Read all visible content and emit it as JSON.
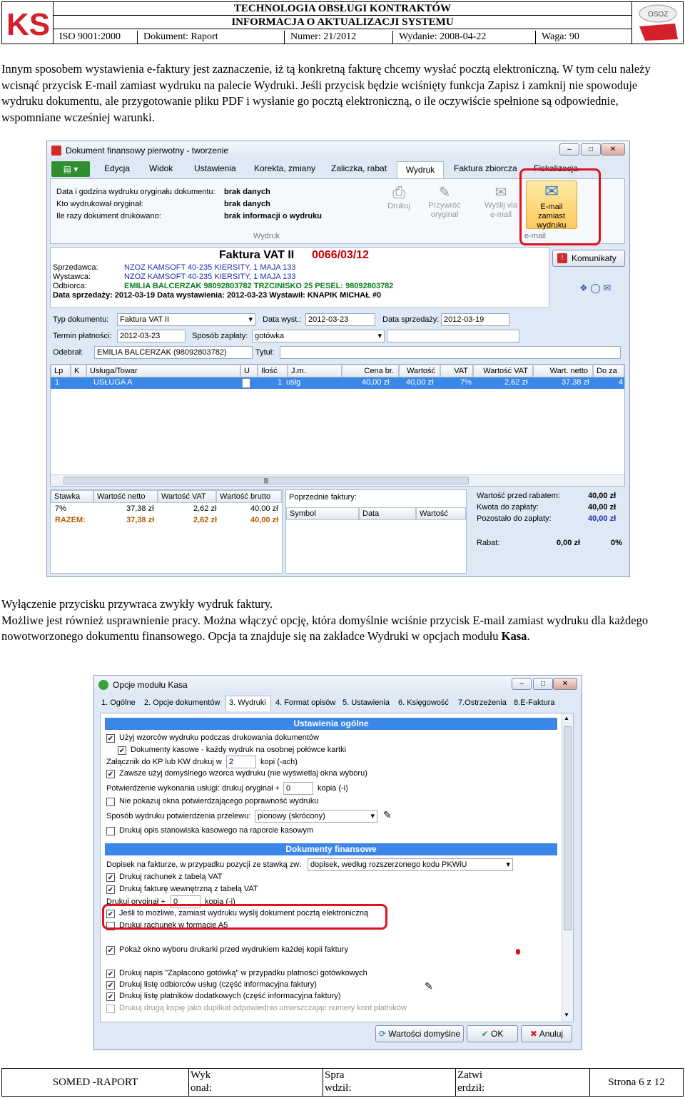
{
  "header": {
    "title1": "TECHNOLOGIA OBSŁUGI KONTRAKTÓW",
    "title2": "INFORMACJA O AKTUALIZACJI SYSTEMU",
    "iso": "ISO 9001:2000",
    "dokument": "Dokument: Raport",
    "numer": "Numer: 21/2012",
    "wydanie": "Wydanie: 2008-04-22",
    "waga": "Waga: 90",
    "logo_left": "KS",
    "logo_right": "OSOZ"
  },
  "para1": "Innym sposobem wystawienia e-faktury jest zaznaczenie, iż tą konkretną fakturę chcemy wysłać pocztą elektroniczną. W tym celu należy wcisnąć przycisk E-mail zamiast wydruku na palecie Wydruki. Jeśli przycisk będzie wciśnięty funkcja Zapisz i zamknij nie spowoduje wydruku dokumentu, ale przygotowanie pliku PDF i wysłanie go pocztą elektroniczną, o ile oczywiście spełnione są odpowiednie, wspomniane wcześniej warunki.",
  "para2_line1": "Wyłączenie przycisku przywraca zwykły wydruk faktury.",
  "para2_line2": "Możliwe jest również usprawnienie pracy. Można włączyć opcję, która domyślnie wciśnie przycisk E-mail zamiast wydruku dla każdego nowotworzonego dokumentu finansowego. Opcja ta znajduje się na zakładce Wydruki w opcjach modułu",
  "para2_bold": "Kasa",
  "para2_end": ".",
  "win1": {
    "title": "Dokument finansowy pierwotny - tworzenie",
    "menu": [
      "Edycja",
      "Widok",
      "Ustawienia",
      "Korekta, zmiany",
      "Zaliczka, rabat",
      "Wydruk",
      "Faktura zbiorcza",
      "Fiskalizacja"
    ],
    "info": [
      {
        "label": "Data i godzina wydruku oryginału dokumentu:",
        "value": "brak danych"
      },
      {
        "label": "Kto wydrukował oryginał:",
        "value": "brak danych"
      },
      {
        "label": "Ile razy dokument drukowano:",
        "value": "brak informacji o wydruku"
      }
    ],
    "group_wydruk": "Wydruk",
    "tools": [
      "Drukuj",
      "Przywróć oryginał",
      "Wyślij via e-mail",
      "E-mail zamiast wydruku"
    ],
    "group_email": "e-mail",
    "doc_title": "Faktura VAT II",
    "doc_number": "0066/03/12",
    "sprzedawca_l": "Sprzedawca:",
    "sprzedawca": "NZOZ KAMSOFT 40-235 KIERSITY, 1 MAJA 133",
    "wystawca_l": "Wystawca:",
    "wystawca": "NZOZ KAMSOFT 40-235 KIERSITY, 1 MAJA 133",
    "odbiorca_l": "Odbiorca:",
    "odbiorca": "EMILIA BALCERZAK 98092803782 TRZCINISKO 25 PESEL: 98092803782",
    "daty": "Data sprzedaży: 2012-03-19  Data wystawienia: 2012-03-23  Wystawił: KNAPIK MICHAŁ #0",
    "komunikaty": "Komunikaty",
    "typ_l": "Typ dokumentu:",
    "typ": "Faktura VAT II",
    "data_wyst_l": "Data wyst.:",
    "data_wyst": "2012-03-23",
    "data_sprz_l": "Data sprzedaży:",
    "data_sprz": "2012-03-19",
    "termin_l": "Termin płatności:",
    "termin": "2012-03-23",
    "sposob_l": "Sposób zapłaty:",
    "sposob": "gotówka",
    "odebral_l": "Odebrał:",
    "odebral": "EMILIA BALCERZAK (98092803782)",
    "tytul_l": "Tytuł:",
    "cols": [
      "Lp",
      "K",
      "Usługa/Towar",
      "U",
      "Ilość",
      "J.m.",
      "Cena br.",
      "Wartość",
      "VAT",
      "Wartość VAT",
      "Wart. netto",
      "Do za"
    ],
    "row": [
      "1",
      "",
      "USŁUGA A",
      "",
      "1",
      "usłg",
      "40,00 zł",
      "40,00 zł",
      "7%",
      "2,62 zł",
      "37,38 zł",
      "4"
    ],
    "vat_cols": [
      "Stawka",
      "Wartość netto",
      "Wartość VAT",
      "Wartość brutto"
    ],
    "vat_row": [
      "7%",
      "37,38 zł",
      "2,62 zł",
      "40,00 zł"
    ],
    "vat_total": [
      "RAZEM:",
      "37,38 zł",
      "2,62 zł",
      "40,00 zł"
    ],
    "poprzednie": "Poprzednie faktury:",
    "prev_cols": [
      "Symbol",
      "Data",
      "Wartość"
    ],
    "sum": [
      {
        "label": "Wartość przed rabatem:",
        "value": "40,00 zł"
      },
      {
        "label": "Kwota do zapłaty:",
        "value": "40,00 zł"
      },
      {
        "label": "Pozostało do zapłaty:",
        "value": "40,00 zł"
      }
    ],
    "rabat_l": "Rabat:",
    "rabat": "0,00 zł",
    "rabat_p": "0%"
  },
  "win2": {
    "title": "Opcje modułu Kasa",
    "tabs": [
      "1. Ogólne",
      "2. Opcje dokumentów",
      "3. Wydruki",
      "4. Format opisów",
      "5. Ustawienia",
      "6. Księgowość",
      "7.Ostrzeżenia",
      "8.E-Faktura"
    ],
    "sect1": "Ustawienia ogólne",
    "opt1": "Użyj wzorców wydruku podczas drukowania dokumentów",
    "opt2": "Dokumenty kasowe - każdy wydruk na osobnej połówce kartki",
    "opt3a": "Załącznik do KP lub KW drukuj w",
    "opt3v": "2",
    "opt3b": "kopi (-ach)",
    "opt4": "Zawsze użyj domyślnego wzorca wydruku (nie wyświetlaj okna wyboru)",
    "opt5a": "Potwierdzenie wykonania usługi: drukuj oryginał +",
    "opt5v": "0",
    "opt5b": "kopia (-i)",
    "opt6": "Nie pokazuj okna potwierdzającego poprawność wydruku",
    "opt7a": "Sposób wydruku potwierdzenia przelewu:",
    "opt7v": "pionowy (skrócony)",
    "opt8": "Drukuj opis stanowiska kasowego na raporcie kasowym",
    "sect2": "Dokumenty finansowe",
    "opt9a": "Dopisek na fakturze, w przypadku pozycji ze stawką zw:",
    "opt9v": "dopisek, według rozszerzonego kodu PKWiU",
    "opt10": "Drukuj rachunek z tabelą VAT",
    "opt11": "Drukuj fakturę wewnętrzną z tabelą VAT",
    "opt12a": "Drukuj oryginał +",
    "opt12v": "0",
    "opt12b": "kopia (-i)",
    "opt13": "Jeśli to możliwe, zamiast wydruku wyślij dokument pocztą elektroniczną",
    "opt14": "Drukuj rachunek w formacie A5",
    "opt15": "Pokaż okno wyboru drukarki przed wydrukiem każdej kopii faktury",
    "opt16": "Drukuj napis \"Zapłacono gotówką\" w przypadku płatności gotówkowych",
    "opt17": "Drukuj listę odbiorców usług (część informacyjna faktury)",
    "opt18": "Drukuj listę płatników dodatkowych (część informacyjna faktury)",
    "opt19": "Drukuj drugą kopię jako duplikat odpowiednio umieszczając numery kont płatników",
    "btn_defaults": "Wartości domyślne",
    "btn_ok": "OK",
    "btn_cancel": "Anuluj"
  },
  "footer": {
    "somed": "SOMED -RAPORT",
    "wyk": "Wyk",
    "wyk2": "onał:",
    "spr": "Spra",
    "spr2": "wdził:",
    "zatw": "Zatwi",
    "zatw2": "erdził:",
    "strona": "Strona 6 z 12"
  },
  "colors": {
    "accent_blue": "#3a87e8",
    "highlight_red": "#e01020",
    "toolbar_green": "#2f8f2f"
  }
}
